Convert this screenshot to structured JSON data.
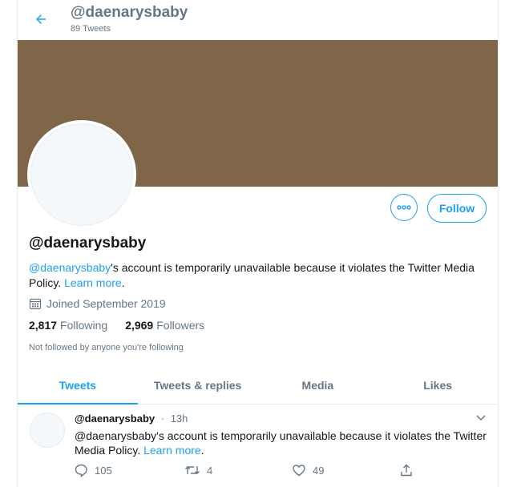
{
  "header": {
    "title": "@daenarysbaby",
    "tweet_count": "89 Tweets"
  },
  "profile": {
    "banner_color": "#7f6649",
    "name": "@daenarysbaby",
    "bio_handle": "@daenarysbaby",
    "bio_text": "'s account is temporarily unavailable because it violates the Twitter Media Policy.",
    "bio_link": "Learn more",
    "bio_end": ".",
    "joined": "Joined September 2019",
    "following_count": "2,817",
    "following_label": "Following",
    "followers_count": "2,969",
    "followers_label": "Followers",
    "not_followed": "Not followed by anyone you're following",
    "follow_button": "Follow"
  },
  "tabs": [
    {
      "label": "Tweets",
      "active": true
    },
    {
      "label": "Tweets & replies"
    },
    {
      "label": "Media"
    },
    {
      "label": "Likes"
    }
  ],
  "tweet": {
    "handle": "@daenarysbaby",
    "sep": "·",
    "time": "13h",
    "text": "@daenarysbaby's account is temporarily unavailable because it violates the Twitter Media Policy.",
    "link": "Learn more",
    "end": ".",
    "replies": "105",
    "retweets": "4",
    "likes": "49"
  },
  "colors": {
    "accent": "#1da1f2",
    "muted": "#657786",
    "border": "#e6ecf0"
  },
  "icons": [
    "back-arrow-icon",
    "more-options-icon",
    "calendar-icon",
    "chevron-down-icon",
    "reply-icon",
    "retweet-icon",
    "like-icon",
    "share-icon"
  ]
}
